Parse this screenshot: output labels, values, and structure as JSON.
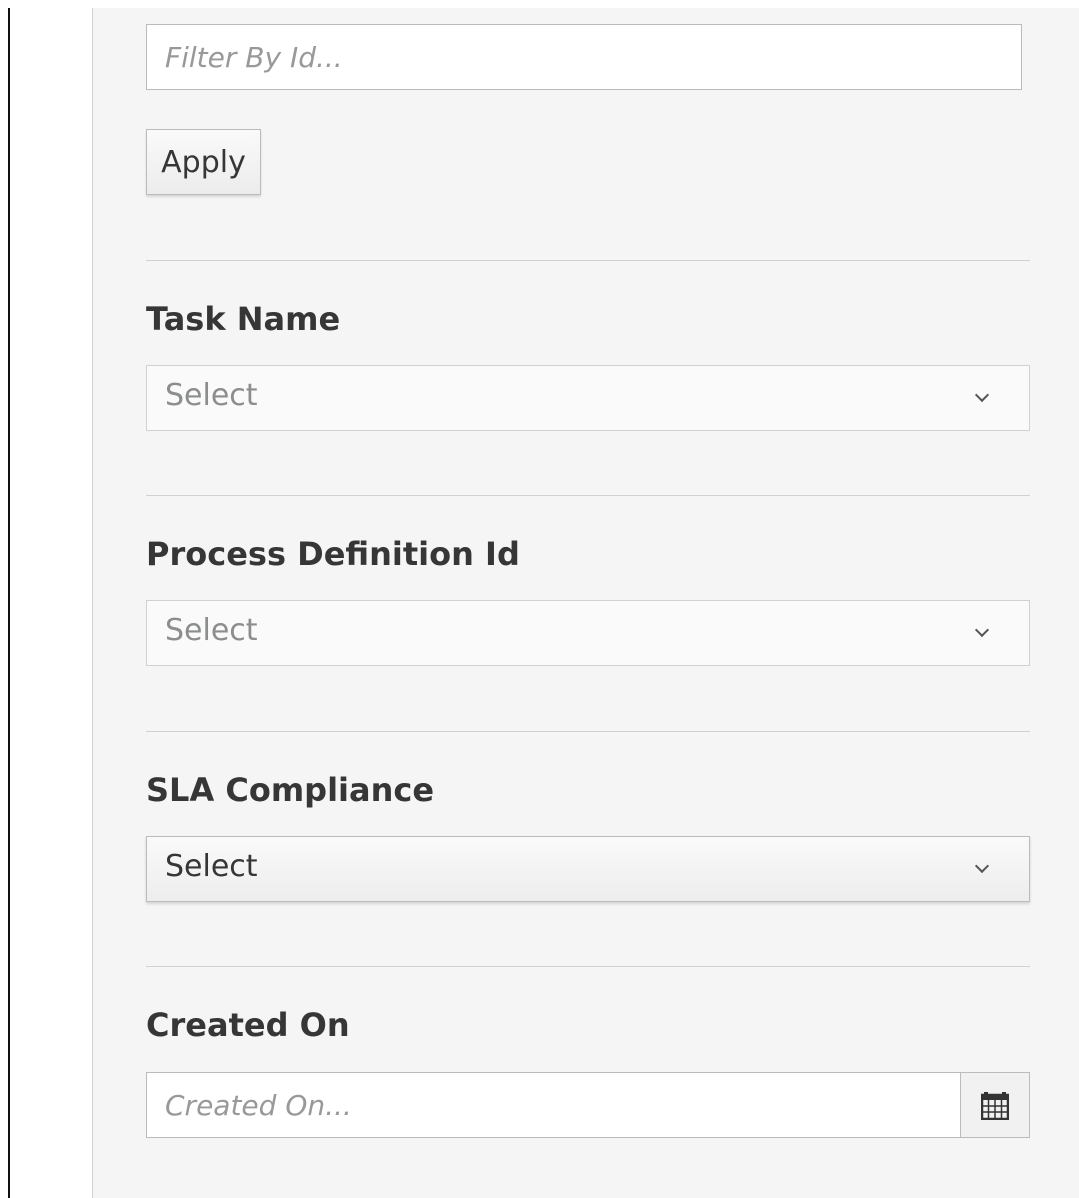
{
  "filter_id": {
    "placeholder": "Filter By Id...",
    "apply_label": "Apply"
  },
  "filters": {
    "task_name": {
      "label": "Task Name",
      "value": "Select"
    },
    "process_definition_id": {
      "label": "Process Definition Id",
      "value": "Select"
    },
    "sla_compliance": {
      "label": "SLA Compliance",
      "value": "Select"
    },
    "created_on": {
      "label": "Created On",
      "placeholder": "Created On..."
    }
  },
  "icons": {
    "select_arrow": "chevron-down-icon",
    "date_picker": "calendar-icon"
  },
  "colors": {
    "panel_background": "#f5f5f5",
    "border": "#bbbbbb",
    "label_text": "#363636",
    "placeholder_text": "#999999"
  }
}
